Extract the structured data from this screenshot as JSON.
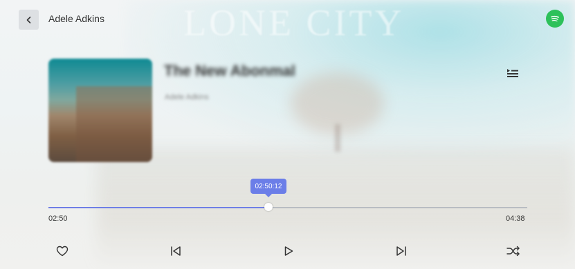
{
  "header": {
    "back_icon": "chevron-left-icon",
    "title": "Adele Adkins",
    "service_icon": "spotify-icon",
    "service_color": "#2dc15a"
  },
  "background": {
    "text": "LONE CITY"
  },
  "track": {
    "title": "The New Abonmal",
    "artist": "Adele Adkins",
    "queue_icon": "queue-icon"
  },
  "progress": {
    "fraction": 0.46,
    "tooltip": "02:50:12",
    "elapsed": "02:50",
    "duration": "04:38",
    "accent": "#6e7ee6"
  },
  "controls": {
    "like_icon": "heart-icon",
    "previous_icon": "skip-previous-icon",
    "play_icon": "play-icon",
    "next_icon": "skip-next-icon",
    "shuffle_icon": "shuffle-icon"
  }
}
